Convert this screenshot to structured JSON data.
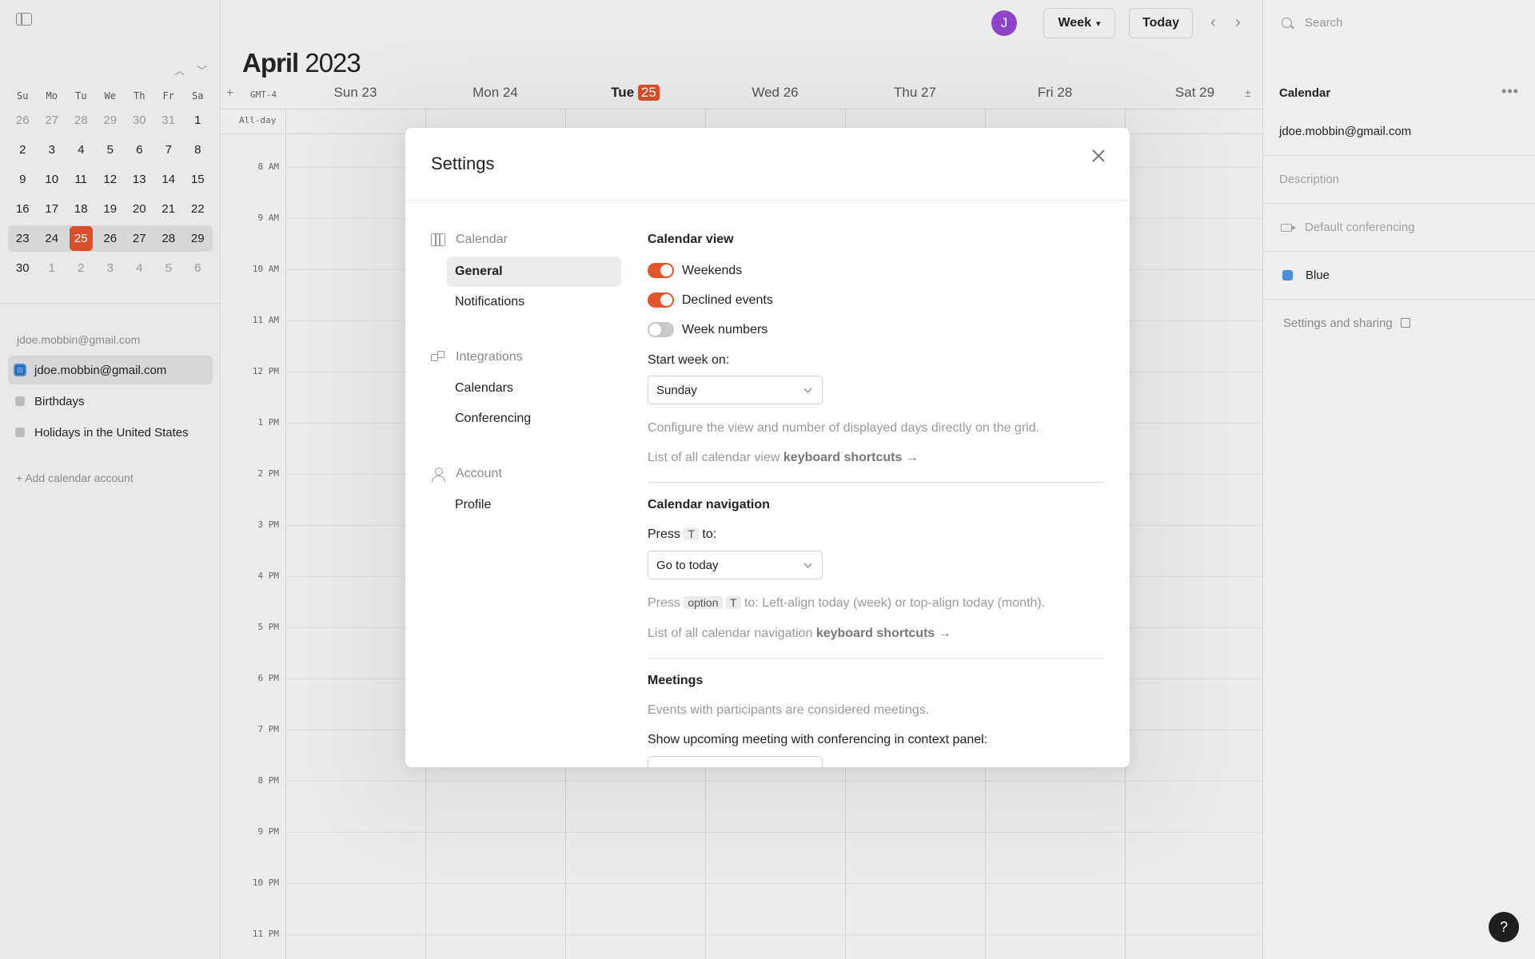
{
  "colors": {
    "accent": "#e2552c",
    "today": "#d94f2b",
    "avatar": "#8e44c9",
    "calendar_blue": "#4d8fd6"
  },
  "sidebar": {
    "toggle_icon": "sidebar-toggle-icon",
    "weekday_headers": [
      "Su",
      "Mo",
      "Tu",
      "We",
      "Th",
      "Fr",
      "Sa"
    ],
    "weeks": [
      [
        "26",
        "27",
        "28",
        "29",
        "30",
        "31",
        "1"
      ],
      [
        "2",
        "3",
        "4",
        "5",
        "6",
        "7",
        "8"
      ],
      [
        "9",
        "10",
        "11",
        "12",
        "13",
        "14",
        "15"
      ],
      [
        "16",
        "17",
        "18",
        "19",
        "20",
        "21",
        "22"
      ],
      [
        "23",
        "24",
        "25",
        "26",
        "27",
        "28",
        "29"
      ],
      [
        "30",
        "1",
        "2",
        "3",
        "4",
        "5",
        "6"
      ]
    ],
    "account_label": "jdoe.mobbin@gmail.com",
    "calendars": [
      "jdoe.mobbin@gmail.com",
      "Birthdays",
      "Holidays in the United States"
    ],
    "add_account": "+  Add calendar account"
  },
  "header": {
    "avatar_letter": "J",
    "view_select": "Week",
    "today_button": "Today",
    "month": "April",
    "year": "2023",
    "timezone": "GMT-4",
    "days": [
      "Sun 23",
      "Mon 24",
      "Tue",
      "Wed 26",
      "Thu 27",
      "Fri 28",
      "Sat 29"
    ],
    "today_num": "25",
    "allday": "All-day",
    "hours": [
      "8 AM",
      "9 AM",
      "10 AM",
      "11 AM",
      "12 PM",
      "1 PM",
      "2 PM",
      "3 PM",
      "4 PM",
      "5 PM",
      "6 PM",
      "7 PM",
      "8 PM",
      "9 PM",
      "10 PM",
      "11 PM"
    ],
    "plusminus": "±"
  },
  "right_panel": {
    "search_placeholder": "Search",
    "title": "Calendar",
    "email": "jdoe.mobbin@gmail.com",
    "description": "Description",
    "conferencing": "Default conferencing",
    "color": "Blue",
    "settings_link": "Settings and sharing"
  },
  "settings": {
    "title": "Settings",
    "nav": {
      "calendar": "Calendar",
      "general": "General",
      "notifications": "Notifications",
      "integrations": "Integrations",
      "calendars": "Calendars",
      "conferencing": "Conferencing",
      "account": "Account",
      "profile": "Profile"
    },
    "calendar_view": {
      "title": "Calendar view",
      "weekends": "Weekends",
      "weekends_on": true,
      "declined": "Declined events",
      "declined_on": true,
      "week_numbers": "Week numbers",
      "week_numbers_on": false,
      "start_week_label": "Start week on:",
      "start_week_value": "Sunday",
      "hint": "Configure the view and number of displayed days directly on the grid.",
      "shortcuts_prefix": "List of all calendar view",
      "shortcuts_link": "keyboard shortcuts →"
    },
    "calendar_navigation": {
      "title": "Calendar navigation",
      "press": "Press",
      "key_t": "T",
      "to": "to:",
      "action_value": "Go to today",
      "option_key": "option",
      "option_hint": "to: Left-align today (week) or top-align today (month).",
      "shortcuts_prefix": "List of all calendar navigation",
      "shortcuts_link": "keyboard shortcuts →"
    },
    "meetings": {
      "title": "Meetings",
      "hint": "Events with participants are considered meetings.",
      "upcoming_label": "Show upcoming meeting with conferencing in context panel:"
    }
  },
  "help": "?"
}
